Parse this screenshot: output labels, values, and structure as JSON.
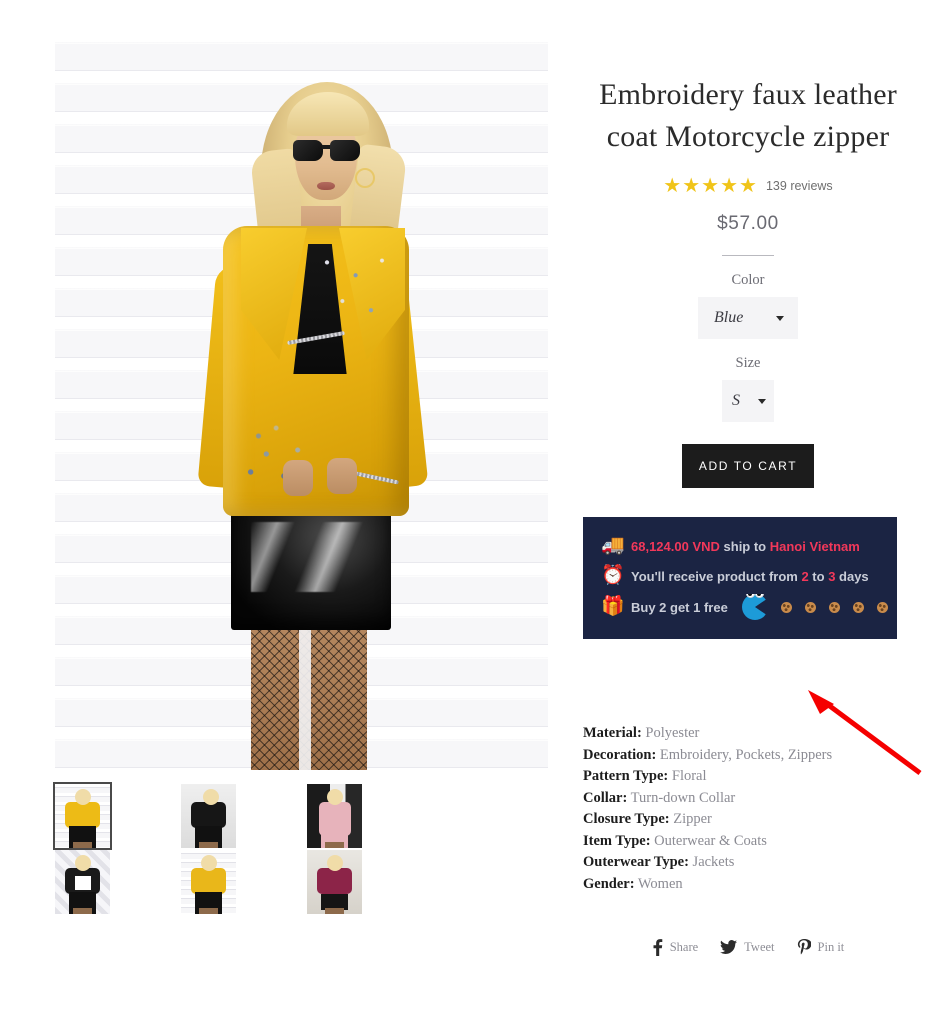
{
  "product": {
    "title": "Embroidery faux leather coat Motorcycle zipper",
    "rating_stars": 5,
    "star_glyph": "★",
    "review_count": "139 reviews",
    "price": "$57.00"
  },
  "options": {
    "color": {
      "label": "Color",
      "value": "Blue"
    },
    "size": {
      "label": "Size",
      "value": "S"
    }
  },
  "cart": {
    "add_label": "ADD TO CART"
  },
  "shipping_banner": {
    "rows": [
      {
        "icon": "truck-icon",
        "glyph": "🚚",
        "parts": [
          {
            "text": "68,124.00 VND",
            "highlight": true
          },
          {
            "text": " ship to ",
            "highlight": false
          },
          {
            "text": "Hanoi Vietnam",
            "highlight": true
          }
        ]
      },
      {
        "icon": "clock-icon",
        "glyph": "⏰",
        "parts": [
          {
            "text": "You'll receive product from ",
            "highlight": false
          },
          {
            "text": "2",
            "highlight": true
          },
          {
            "text": " to ",
            "highlight": false
          },
          {
            "text": "3",
            "highlight": true
          },
          {
            "text": " days",
            "highlight": false
          }
        ]
      },
      {
        "icon": "gift-icon",
        "glyph": "🎁",
        "parts": [
          {
            "text": "Buy 2 get 1 free",
            "highlight": false
          }
        ]
      }
    ],
    "cookie_count": 5,
    "bg_color": "#1b2443",
    "highlight_color": "#f2385a",
    "text_color": "#c9cdd8",
    "pacman_color": "#1d9bd8"
  },
  "specs": [
    {
      "key": "Material:",
      "value": "Polyester"
    },
    {
      "key": "Decoration:",
      "value": "Embroidery, Pockets, Zippers"
    },
    {
      "key": "Pattern Type:",
      "value": "Floral"
    },
    {
      "key": "Collar:",
      "value": "Turn-down Collar"
    },
    {
      "key": "Closure Type:",
      "value": "Zipper"
    },
    {
      "key": "Item Type:",
      "value": "Outerwear & Coats"
    },
    {
      "key": "Outerwear Type:",
      "value": "Jackets"
    },
    {
      "key": "Gender:",
      "value": "Women"
    }
  ],
  "share": [
    {
      "icon": "facebook-icon",
      "label": "Share"
    },
    {
      "icon": "twitter-icon",
      "label": "Tweet"
    },
    {
      "icon": "pinterest-icon",
      "label": "Pin it"
    }
  ],
  "gallery": {
    "main_alt": "Model wearing yellow embroidered faux leather moto jacket and black vinyl skirt",
    "thumbnails": [
      {
        "alt": "Yellow jacket front view",
        "active": true
      },
      {
        "alt": "Black jacket view",
        "active": false
      },
      {
        "alt": "Pink coat view",
        "active": false
      },
      {
        "alt": "Black jacket white top view",
        "active": false
      },
      {
        "alt": "Yellow jacket side view",
        "active": false
      },
      {
        "alt": "Burgundy jacket view",
        "active": false
      }
    ]
  },
  "annotation": {
    "arrow_color": "#f50000"
  }
}
